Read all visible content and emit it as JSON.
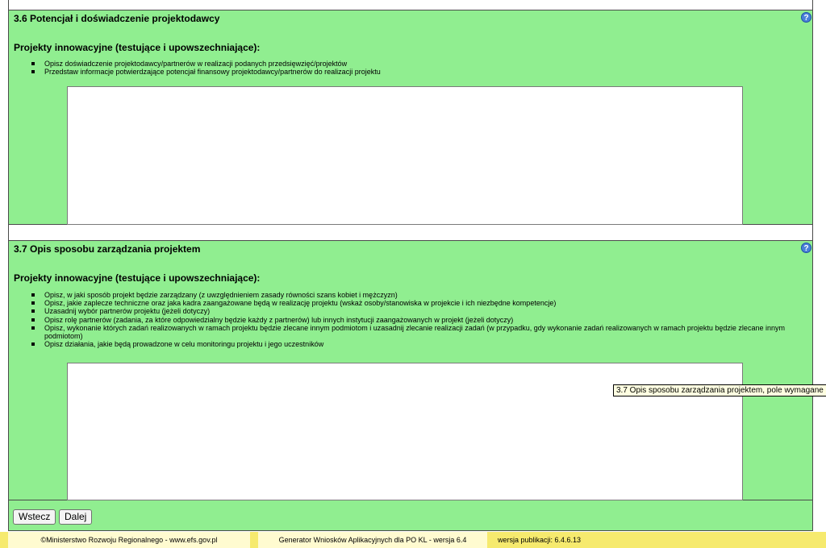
{
  "section_36": {
    "title": "3.6 Potencjał i doświadczenie projektodawcy",
    "help_glyph": "?",
    "subtitle": "Projekty innowacyjne (testujące i upowszechniające):",
    "bullets": [
      "Opisz doświadczenie projektodawcy/partnerów w realizacji podanych przedsięwzięć/projektów",
      "Przedstaw informacje potwierdzające potencjał finansowy projektodawcy/partnerów do realizacji projektu"
    ],
    "textarea_value": ""
  },
  "section_37": {
    "title": "3.7 Opis sposobu zarządzania projektem",
    "help_glyph": "?",
    "subtitle": "Projekty innowacyjne (testujące i upowszechniające):",
    "bullets": [
      "Opisz, w jaki sposób projekt będzie zarządzany (z uwzględnieniem zasady równości szans kobiet i mężczyzn)",
      "Opisz, jakie zaplecze techniczne oraz jaka kadra zaangażowane będą w realizację projektu (wskaż osoby/stanowiska w projekcie i ich niezbędne kompetencje)",
      "Uzasadnij wybór partnerów projektu (jeżeli dotyczy)",
      "Opisz rolę partnerów (zadania, za które odpowiedzialny będzie każdy z partnerów) lub innych instytucji zaangażowanych w projekt (jeżeli dotyczy)",
      "Opisz, wykonanie których zadań realizowanych w ramach projektu będzie zlecane innym podmiotom i uzasadnij zlecanie realizacji zadań (w przypadku, gdy wykonanie zadań realizowanych w ramach projektu będzie zlecane innym podmiotom)",
      "Opisz działania, jakie będą prowadzone w celu monitoringu projektu i jego uczestników"
    ],
    "textarea_value": "",
    "tooltip": "3.7 Opis sposobu zarządzania projektem, pole wymagane"
  },
  "nav": {
    "back_label": "Wstecz",
    "next_label": "Dalej"
  },
  "footer": {
    "ministry": "©Ministerstwo Rozwoju Regionalnego - www.efs.gov.pl",
    "generator": "Generator Wniosków Aplikacyjnych dla PO KL - wersja 6.4",
    "version": "wersja publikacji: 6.4.6.13"
  },
  "colors": {
    "section_bg": "#90ee90",
    "footer_bg": "#f6ea6e",
    "tooltip_bg": "#ffffe1"
  }
}
